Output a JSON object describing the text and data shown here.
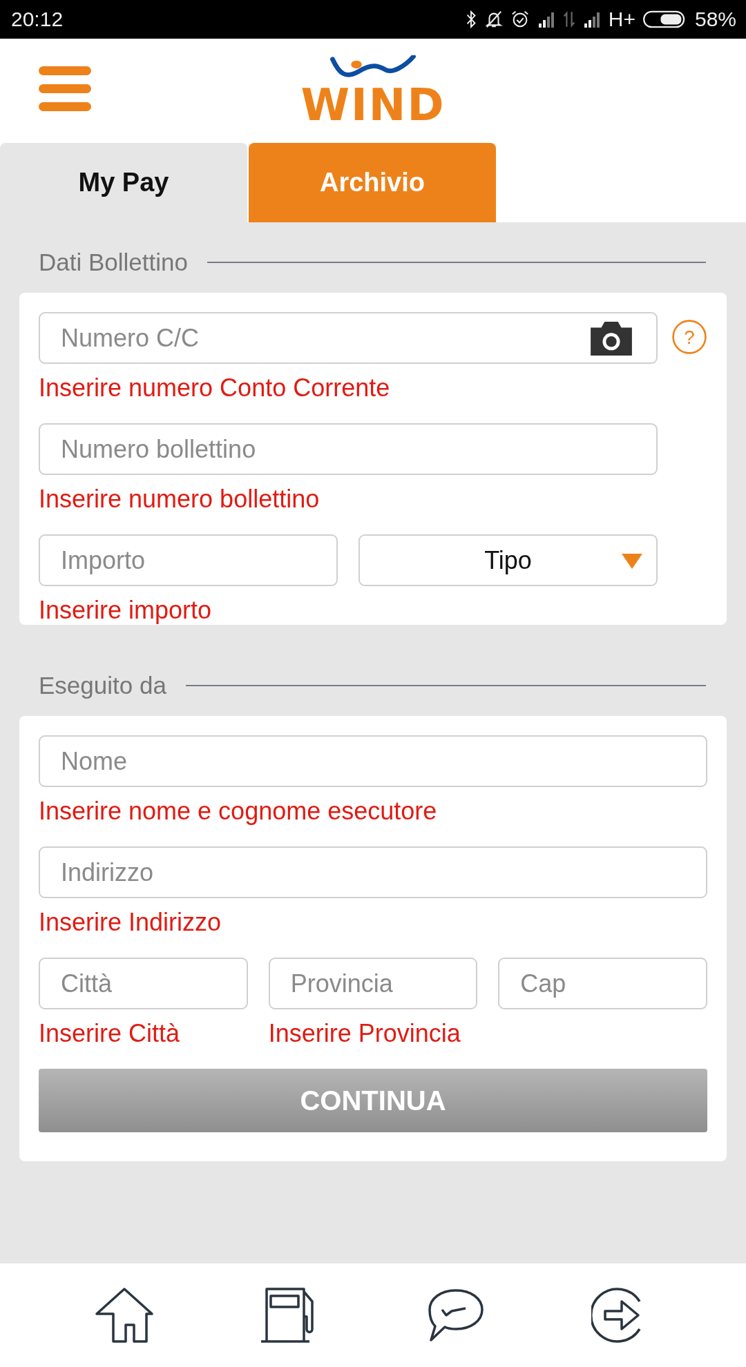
{
  "status_bar": {
    "time": "20:12",
    "network": "H+",
    "battery": "58%"
  },
  "header": {
    "logo_text": "WIND"
  },
  "tabs": [
    {
      "label": "My Pay",
      "selected": false
    },
    {
      "label": "Archivio",
      "selected": true
    }
  ],
  "sections": [
    {
      "title": "Dati Bollettino",
      "rows": [
        {
          "help": "?",
          "fields": [
            {
              "kind": "camera",
              "placeholder": "Numero C/C",
              "error": "Inserire numero Conto Corrente"
            }
          ]
        },
        {
          "fields": [
            {
              "kind": "input",
              "placeholder": "Numero bollettino",
              "error": "Inserire numero bollettino"
            }
          ]
        },
        {
          "fields": [
            {
              "kind": "input",
              "placeholder": "Importo",
              "error": "Inserire importo"
            },
            {
              "kind": "select",
              "value": "Tipo"
            }
          ]
        }
      ]
    },
    {
      "title": "Eseguito da",
      "rows": [
        {
          "fields": [
            {
              "kind": "input",
              "placeholder": "Nome",
              "error": "Inserire nome e cognome esecutore"
            }
          ]
        },
        {
          "fields": [
            {
              "kind": "input",
              "placeholder": "Indirizzo",
              "error": "Inserire Indirizzo"
            }
          ]
        },
        {
          "fields": [
            {
              "kind": "input",
              "placeholder": "Città",
              "error": "Inserire Città"
            },
            {
              "kind": "input",
              "placeholder": "Provincia",
              "error": "Inserire Provincia"
            },
            {
              "kind": "input",
              "placeholder": "Cap"
            }
          ]
        }
      ],
      "button": {
        "label": "CONTINUA",
        "disabled": true
      }
    }
  ],
  "bottom_nav": [
    {
      "kind": "home"
    },
    {
      "kind": "fuel"
    },
    {
      "kind": "chat"
    },
    {
      "kind": "exit"
    }
  ]
}
